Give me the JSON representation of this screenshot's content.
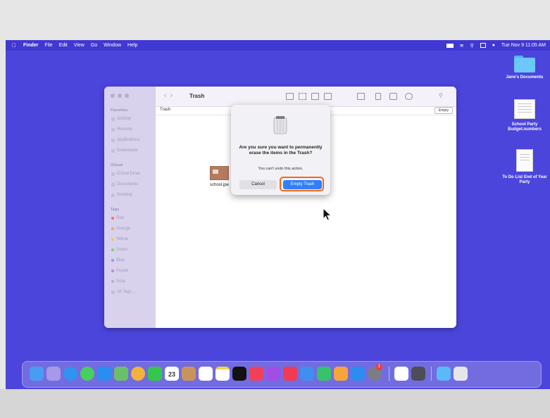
{
  "menubar": {
    "apple": "",
    "items": [
      "Finder",
      "File",
      "Edit",
      "View",
      "Go",
      "Window",
      "Help"
    ],
    "clock": "Tue Nov 9  11:05 AM"
  },
  "desktop_icons": [
    {
      "label": "Jane's Documents",
      "kind": "folder"
    },
    {
      "label": "School Party Budget.numbers",
      "kind": "spreadsheet"
    },
    {
      "label": "To Do List End of Year Party",
      "kind": "document"
    }
  ],
  "finder": {
    "title": "Trash",
    "path": "Trash",
    "empty_button": "Empty",
    "sidebar": {
      "favorites_header": "Favorites",
      "favorites": [
        "AirDrop",
        "Recents",
        "Applications",
        "Downloads"
      ],
      "icloud_header": "iCloud",
      "icloud": [
        "iCloud Drive",
        "Documents",
        "Desktop"
      ],
      "tags_header": "Tags",
      "tags": [
        {
          "label": "Red",
          "color": "#e9766d"
        },
        {
          "label": "Orange",
          "color": "#efa66a"
        },
        {
          "label": "Yellow",
          "color": "#e6cd6b"
        },
        {
          "label": "Green",
          "color": "#85c77d"
        },
        {
          "label": "Blue",
          "color": "#7ea4ea"
        },
        {
          "label": "Purple",
          "color": "#b18be2"
        },
        {
          "label": "Gray",
          "color": "#b2b0bb"
        }
      ],
      "all_tags": "All Tags..."
    },
    "file": {
      "label": "school.jpe"
    }
  },
  "dialog": {
    "title": "Are you sure you want to permanently erase the items in the Trash?",
    "message": "You can't undo this action.",
    "cancel": "Cancel",
    "confirm": "Empty Trash",
    "highlight_color": "#ef6a1e"
  },
  "dock": {
    "calendar_day": "23",
    "badge": "1"
  }
}
